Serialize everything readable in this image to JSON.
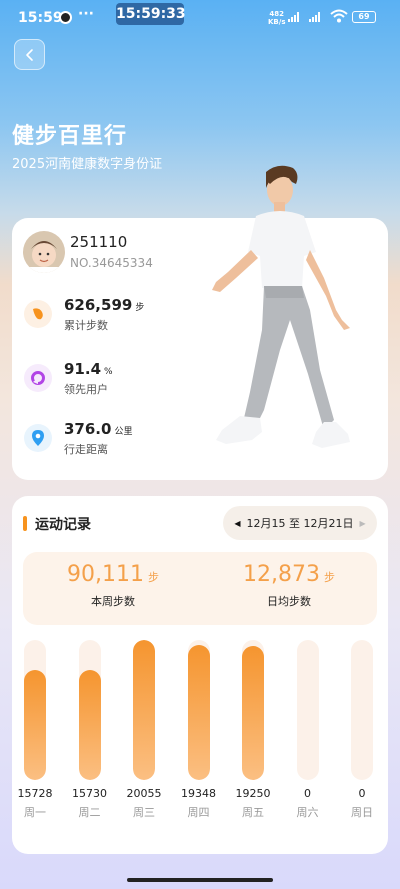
{
  "status_bar": {
    "time": "15:59",
    "more": "···",
    "center_time": "15:59:33",
    "speed_value": "482",
    "speed_unit": "KB/s",
    "battery": "69"
  },
  "header": {
    "title": "健步百里行",
    "subtitle": "2025河南健康数字身份证"
  },
  "profile": {
    "user_id": "251110",
    "number": "NO.34645334"
  },
  "stats": [
    {
      "icon": "footprint-icon",
      "value": "626,599",
      "unit": "步",
      "label": "累计步数",
      "color": "#f7931e",
      "bg": "#fdf0e3"
    },
    {
      "icon": "ring-icon",
      "value": "91.4",
      "unit": "%",
      "label": "领先用户",
      "color": "#b245e6",
      "bg": "#f6ebfc"
    },
    {
      "icon": "location-pin-icon",
      "value": "376.0",
      "unit": "公里",
      "label": "行走距离",
      "color": "#2f9ff2",
      "bg": "#e8f4fd"
    }
  ],
  "activity": {
    "title": "运动记录",
    "date_range": "12月15 至 12月21日",
    "week_steps": {
      "value": "90,111",
      "unit": "步",
      "label": "本周步数"
    },
    "daily_avg": {
      "value": "12,873",
      "unit": "步",
      "label": "日均步数"
    }
  },
  "chart_data": {
    "type": "bar",
    "categories": [
      "周一",
      "周二",
      "周三",
      "周四",
      "周五",
      "周六",
      "周日"
    ],
    "values": [
      15728,
      15730,
      20055,
      19348,
      19250,
      0,
      0
    ],
    "value_labels": [
      "15728",
      "15730",
      "20055",
      "19348",
      "19250",
      "0",
      "0"
    ],
    "ylim": [
      0,
      20055
    ],
    "colors": {
      "fill_top": "#f5952f",
      "fill_bottom": "#fbbf82",
      "track": "#fcf1e9"
    }
  },
  "colors": {
    "accent": "#f7931e",
    "summary_value": "#f4a04a"
  }
}
